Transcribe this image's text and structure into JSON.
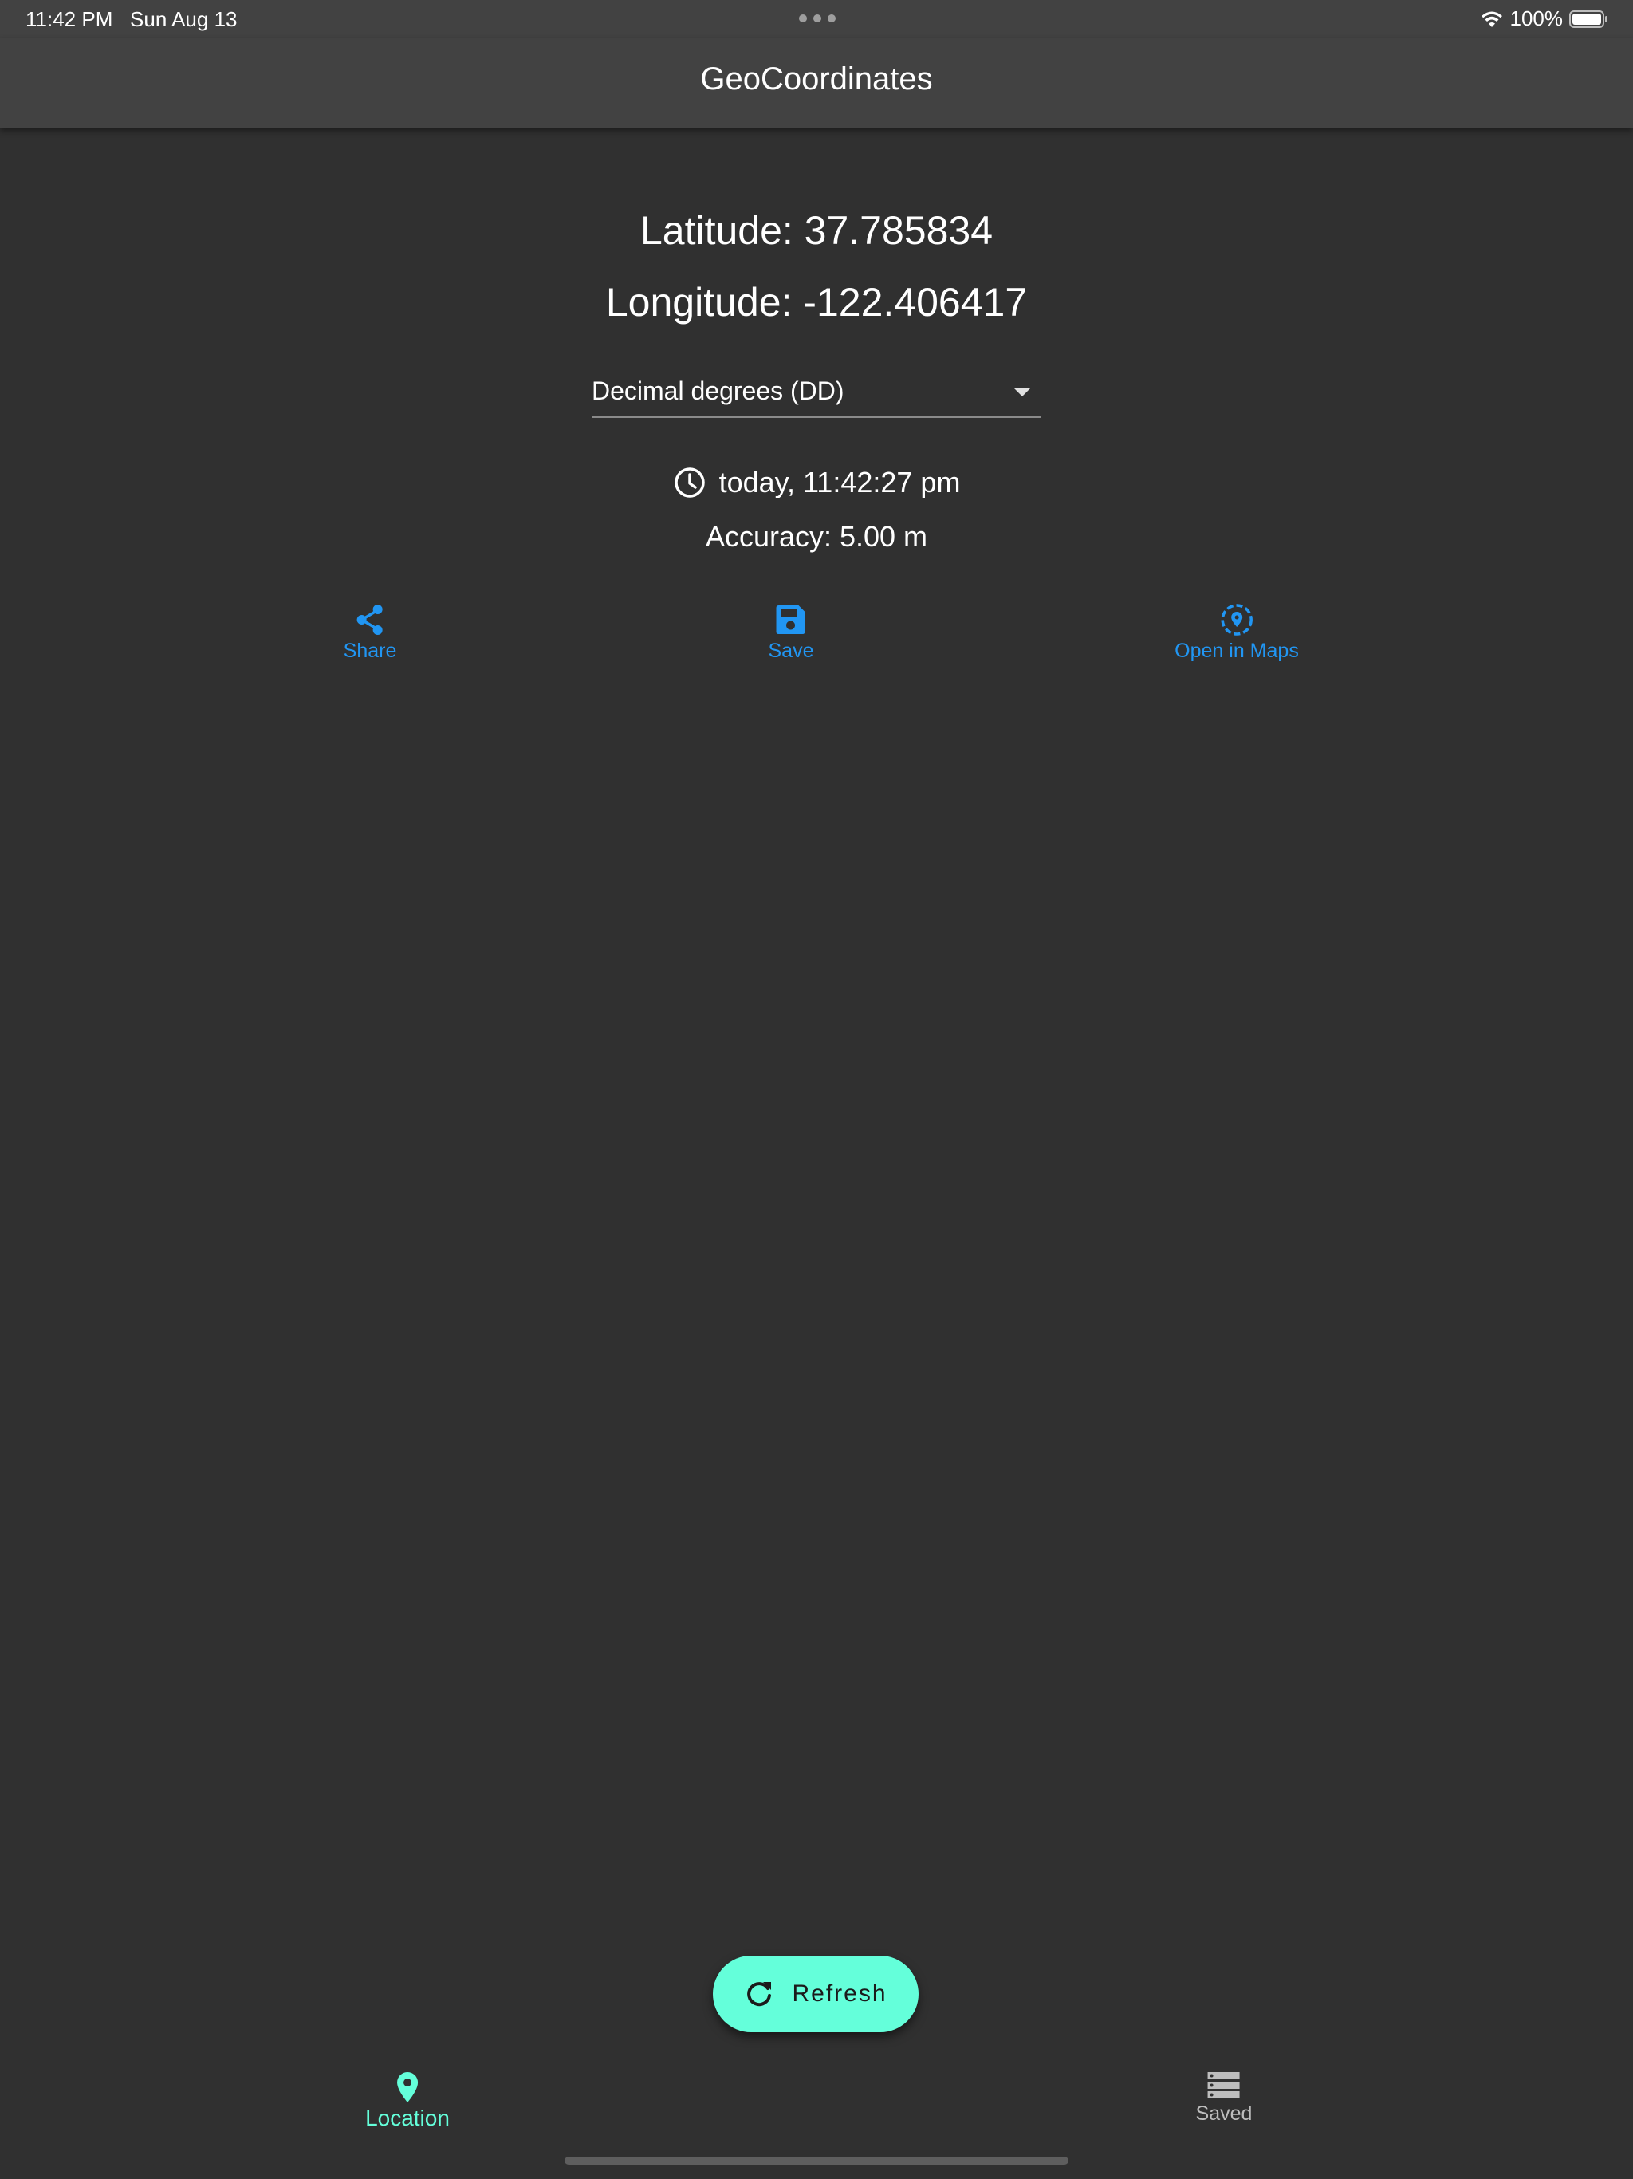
{
  "status_bar": {
    "time": "11:42 PM",
    "date": "Sun Aug 13",
    "battery": "100%"
  },
  "app_bar": {
    "title": "GeoCoordinates"
  },
  "coordinates": {
    "latitude": "Latitude: 37.785834",
    "longitude": "Longitude: -122.406417"
  },
  "format_select": {
    "selected": "Decimal degrees (DD)"
  },
  "timestamp": "today, 11:42:27 pm",
  "accuracy": "Accuracy: 5.00 m",
  "actions": {
    "share": "Share",
    "save": "Save",
    "open_in_maps": "Open in Maps"
  },
  "refresh_button": {
    "label": "Refresh"
  },
  "bottom_nav": {
    "location": "Location",
    "saved": "Saved"
  },
  "colors": {
    "background": "#303030",
    "app_bar": "#424242",
    "action_blue": "#2196f3",
    "accent_teal": "#64ffda",
    "inactive_gray": "#bdbdbd"
  },
  "icons": [
    "wifi-icon",
    "battery-icon",
    "chevron-down-icon",
    "clock-icon",
    "share-icon",
    "save-icon",
    "map-pin-circle-icon",
    "refresh-icon",
    "location-pin-icon",
    "saved-list-icon"
  ]
}
